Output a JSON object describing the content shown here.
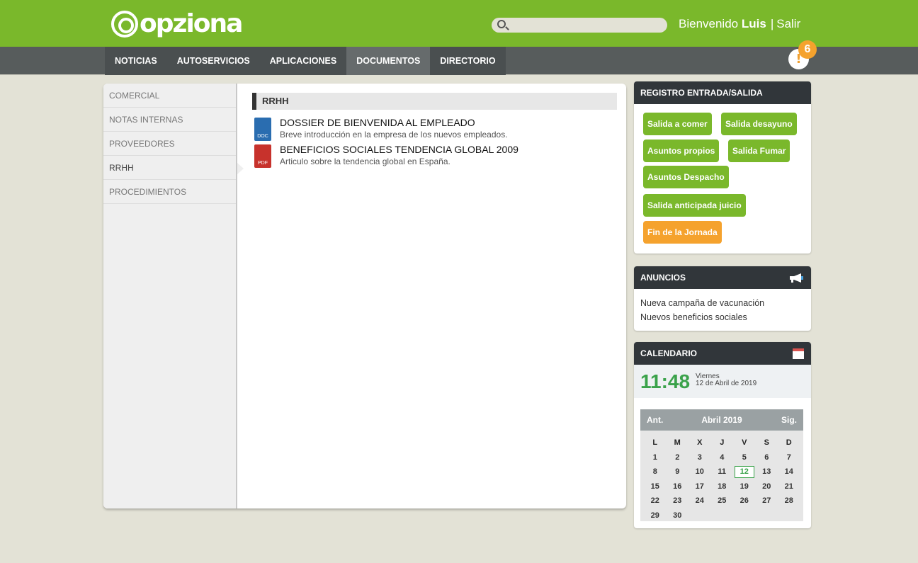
{
  "header": {
    "logo_text": "opziona",
    "search_placeholder": "",
    "welcome_prefix": "Bienvenido",
    "user_name": "Luis",
    "separator": "|",
    "logout": "Salir",
    "notifications_count": "6",
    "notification_glyph": "!"
  },
  "nav": {
    "items": [
      "NOTICIAS",
      "AUTOSERVICIOS",
      "APLICACIONES",
      "DOCUMENTOS",
      "DIRECTORIO"
    ],
    "active": "DOCUMENTOS"
  },
  "sidebar": {
    "items": [
      "COMERCIAL",
      "NOTAS INTERNAS",
      "PROVEEDORES",
      "RRHH",
      "PROCEDIMIENTOS"
    ],
    "active": "RRHH"
  },
  "content": {
    "section_title": "RRHH",
    "documents": [
      {
        "type": "DOC",
        "title": "DOSSIER DE BIENVENIDA AL EMPLEADO",
        "description": "Breve introducción en la empresa de los nuevos empleados."
      },
      {
        "type": "PDF",
        "title": "BENEFICIOS SOCIALES TENDENCIA GLOBAL 2009",
        "description": "Articulo sobre la tendencia global en España."
      }
    ]
  },
  "registro": {
    "title": "REGISTRO ENTRADA/SALIDA",
    "buttons": [
      "Salida a comer",
      "Salida desayuno",
      "Asuntos propios",
      "Salida Fumar",
      "Asuntos Despacho",
      "Salida anticipada juicio",
      "Fin de la Jornada"
    ]
  },
  "anuncios": {
    "title": "ANUNCIOS",
    "items": [
      "Nueva campaña de vacunación",
      "Nuevos beneficios sociales"
    ]
  },
  "calendario": {
    "title": "CALENDARIO",
    "time": "11:48",
    "weekday": "Viernes",
    "date": "12 de Abril de 2019",
    "prev": "Ant.",
    "next": "Sig.",
    "month": "Abril 2019",
    "weekdays": [
      "L",
      "M",
      "X",
      "J",
      "V",
      "S",
      "D"
    ],
    "days": [
      "1",
      "2",
      "3",
      "4",
      "5",
      "6",
      "7",
      "8",
      "9",
      "10",
      "11",
      "12",
      "13",
      "14",
      "15",
      "16",
      "17",
      "18",
      "19",
      "20",
      "21",
      "22",
      "23",
      "24",
      "25",
      "26",
      "27",
      "28",
      "29",
      "30"
    ],
    "today": "12"
  },
  "colors": {
    "brand_green": "#7ab82b",
    "accent_orange": "#f5a22d",
    "dark_header": "#31363a",
    "clock_green": "#3aa24a"
  }
}
